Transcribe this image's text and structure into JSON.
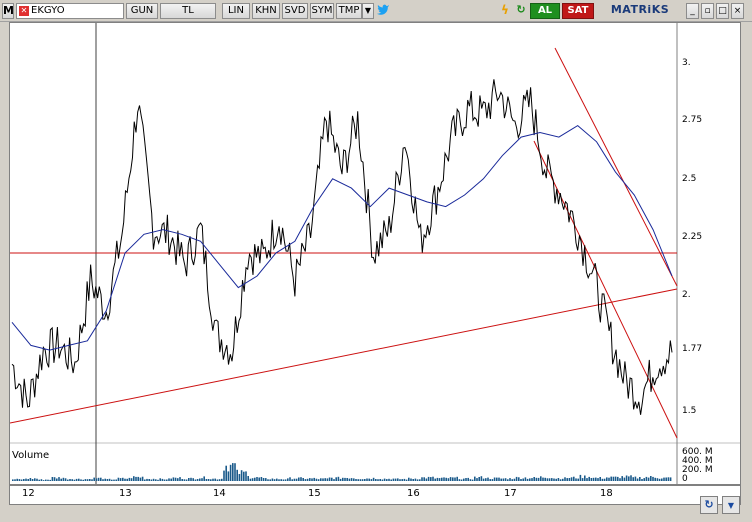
{
  "toolbar": {
    "menu_label": "M",
    "symbol": "EKGYO",
    "period": "GUN",
    "currency": "TL",
    "scale": "LIN",
    "btn_khn": "KHN",
    "btn_svd": "SVD",
    "btn_sym": "SYM",
    "btn_tmp": "TMP",
    "buy_label": "AL",
    "sell_label": "SAT",
    "brand": "MATRiKS"
  },
  "chart": {
    "price_ticks": [
      "3.",
      "2.75",
      "2.5",
      "2.25",
      "2.",
      "1.77",
      "1.5"
    ],
    "volume_label": "Volume",
    "volume_ticks": [
      "600. M",
      "400. M",
      "200. M",
      "0"
    ],
    "x_ticks": [
      "12",
      "13",
      "14",
      "15",
      "16",
      "17",
      "18"
    ],
    "last_price": "1.77"
  },
  "chart_data": {
    "type": "line",
    "title": "",
    "xlabel": "",
    "ylabel": "",
    "x_categories": [
      "12",
      "13",
      "14",
      "15",
      "16",
      "17",
      "18"
    ],
    "ylim": [
      1.4,
      3.15
    ],
    "volume_ylim": [
      0,
      600
    ],
    "series": [
      {
        "values": [
          1.72,
          1.55,
          1.78,
          1.8,
          1.72,
          2.08,
          1.95,
          2.28,
          2.85,
          2.3,
          2.28,
          2.15,
          2.3,
          1.85,
          1.78,
          2.2,
          2.18,
          2.35,
          2.08,
          2.28,
          2.78,
          2.55,
          2.78,
          2.2,
          2.3,
          2.7,
          2.25,
          2.45,
          2.7,
          2.82,
          2.8,
          2.9,
          2.75,
          2.85,
          2.55,
          2.45,
          2.3,
          2.1,
          1.85,
          1.65,
          1.58,
          1.72,
          1.77
        ]
      },
      {
        "values": [
          1.9,
          1.8,
          1.78,
          1.8,
          1.82,
          1.95,
          2.2,
          2.28,
          2.3,
          2.28,
          2.25,
          2.15,
          2.05,
          2.1,
          2.2,
          2.25,
          2.4,
          2.52,
          2.48,
          2.4,
          2.48,
          2.45,
          2.42,
          2.4,
          2.45,
          2.52,
          2.62,
          2.7,
          2.72,
          2.7,
          2.75,
          2.68,
          2.55,
          2.45,
          2.3,
          2.1
        ]
      }
    ],
    "volume": [
      30,
      45,
      25,
      60,
      40,
      35,
      50,
      30,
      45,
      70,
      40,
      35,
      55,
      45,
      60,
      40,
      280,
      150,
      60,
      40,
      35,
      50,
      45,
      40,
      55,
      60,
      45,
      50,
      40,
      35,
      45,
      60,
      50,
      55,
      40,
      65,
      50,
      45,
      60,
      55,
      70,
      50,
      60,
      80,
      55,
      65,
      75,
      60,
      70,
      55
    ]
  },
  "colors": {
    "price_line": "#000000",
    "moving_average": "#1a2a9a",
    "trend_lines": "#cc1010",
    "volume_bars": "#1a5a8a"
  }
}
